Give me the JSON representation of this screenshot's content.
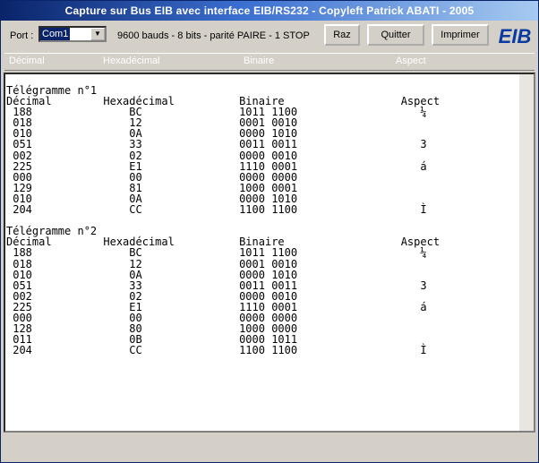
{
  "window": {
    "title": "Capture sur Bus EIB avec interface EIB/RS232  -  Copyleft Patrick ABATI  -  2005"
  },
  "toolbar": {
    "port_label": "Port :",
    "port_value": "Com1",
    "settings_text": "9600 bauds - 8 bits - parité PAIRE - 1 STOP",
    "raz_label": "Raz",
    "quit_label": "Quitter",
    "print_label": "Imprimer",
    "logo_text": "EIB"
  },
  "columns": {
    "decimal": "Décimal",
    "hex": "Hexadécimal",
    "binary": "Binaire",
    "aspect": "Aspect"
  },
  "telegrams": [
    {
      "title": "Télégramme n°1",
      "rows": [
        {
          "dec": "188",
          "hex": "BC",
          "bin": "1011 1100",
          "asp": "¼"
        },
        {
          "dec": "018",
          "hex": "12",
          "bin": "0001 0010",
          "asp": ""
        },
        {
          "dec": "010",
          "hex": "0A",
          "bin": "0000 1010",
          "asp": ""
        },
        {
          "dec": "051",
          "hex": "33",
          "bin": "0011 0011",
          "asp": "3"
        },
        {
          "dec": "002",
          "hex": "02",
          "bin": "0000 0010",
          "asp": ""
        },
        {
          "dec": "225",
          "hex": "E1",
          "bin": "1110 0001",
          "asp": "á"
        },
        {
          "dec": "000",
          "hex": "00",
          "bin": "0000 0000",
          "asp": ""
        },
        {
          "dec": "129",
          "hex": "81",
          "bin": "1000 0001",
          "asp": ""
        },
        {
          "dec": "010",
          "hex": "0A",
          "bin": "0000 1010",
          "asp": ""
        },
        {
          "dec": "204",
          "hex": "CC",
          "bin": "1100 1100",
          "asp": "Ì"
        }
      ]
    },
    {
      "title": "Télégramme n°2",
      "rows": [
        {
          "dec": "188",
          "hex": "BC",
          "bin": "1011 1100",
          "asp": "¼"
        },
        {
          "dec": "018",
          "hex": "12",
          "bin": "0001 0010",
          "asp": ""
        },
        {
          "dec": "010",
          "hex": "0A",
          "bin": "0000 1010",
          "asp": ""
        },
        {
          "dec": "051",
          "hex": "33",
          "bin": "0011 0011",
          "asp": "3"
        },
        {
          "dec": "002",
          "hex": "02",
          "bin": "0000 0010",
          "asp": ""
        },
        {
          "dec": "225",
          "hex": "E1",
          "bin": "1110 0001",
          "asp": "á"
        },
        {
          "dec": "000",
          "hex": "00",
          "bin": "0000 0000",
          "asp": ""
        },
        {
          "dec": "128",
          "hex": "80",
          "bin": "1000 0000",
          "asp": ""
        },
        {
          "dec": "011",
          "hex": "0B",
          "bin": "0000 1011",
          "asp": ""
        },
        {
          "dec": "204",
          "hex": "CC",
          "bin": "1100 1100",
          "asp": "Ì"
        }
      ]
    }
  ],
  "colors": {
    "title_bar": "#0a246a",
    "logo": "#0a3aa0"
  }
}
